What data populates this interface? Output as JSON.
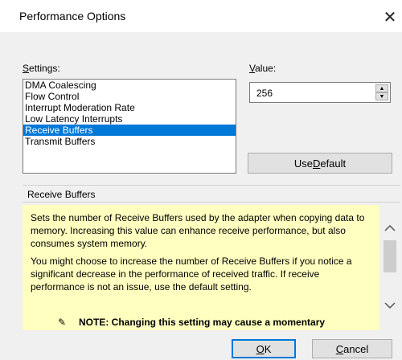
{
  "window": {
    "title": "Performance Options",
    "close_glyph": "✕"
  },
  "settings": {
    "label_prefix": "S",
    "label_rest": "ettings:",
    "items": [
      {
        "label": "DMA Coalescing",
        "selected": false
      },
      {
        "label": "Flow Control",
        "selected": false
      },
      {
        "label": "Interrupt Moderation Rate",
        "selected": false
      },
      {
        "label": "Low Latency Interrupts",
        "selected": false
      },
      {
        "label": "Receive Buffers",
        "selected": true
      },
      {
        "label": "Transmit Buffers",
        "selected": false
      }
    ]
  },
  "value": {
    "label_prefix": "V",
    "label_rest": "alue:",
    "current": "256",
    "spin_up": "▲",
    "spin_down": "▼"
  },
  "use_default": {
    "label_pre": "Use ",
    "label_key": "D",
    "label_post": "efault"
  },
  "description": {
    "header": "Receive Buffers",
    "paragraph1": "Sets the number of Receive Buffers used by the adapter when copying data to memory. Increasing this value can enhance receive performance, but also consumes system memory.",
    "paragraph2": "You might choose to increase the number of Receive Buffers if you notice a significant decrease in the performance of received traffic. If receive performance is not an issue, use the default setting.",
    "note": "NOTE: Changing this setting may cause a momentary"
  },
  "buttons": {
    "ok_key": "O",
    "ok_rest": "K",
    "cancel_key": "C",
    "cancel_rest": "ancel"
  },
  "colors": {
    "selection": "#0078d7",
    "description_bg": "#ffffc0"
  }
}
